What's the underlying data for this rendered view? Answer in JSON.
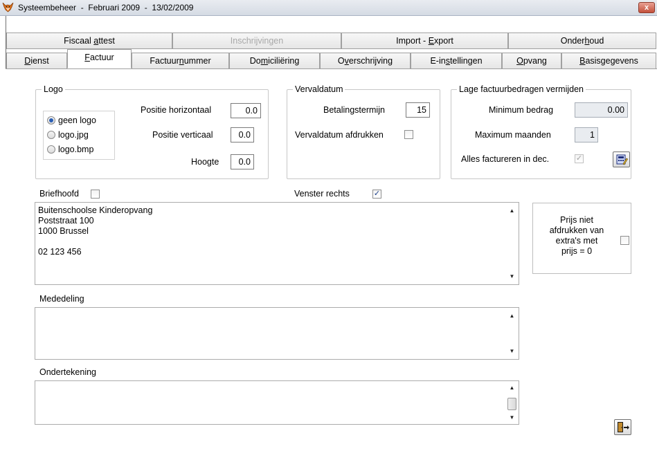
{
  "window": {
    "title": "Systeembeheer  -  Februari 2009  -  13/02/2009",
    "close_glyph": "x"
  },
  "tabs_top": [
    {
      "label_pre": "Fiscaal ",
      "label_u": "a",
      "label_post": "ttest",
      "enabled": true
    },
    {
      "label_pre": "Inschrijvingen",
      "label_u": "",
      "label_post": "",
      "enabled": false
    },
    {
      "label_pre": "Import - ",
      "label_u": "E",
      "label_post": "xport",
      "enabled": true
    },
    {
      "label_pre": "Onder",
      "label_u": "h",
      "label_post": "oud",
      "enabled": true
    }
  ],
  "tabs_bottom": [
    {
      "label_pre": "",
      "label_u": "D",
      "label_post": "ienst"
    },
    {
      "label_pre": "",
      "label_u": "F",
      "label_post": "actuur",
      "active": true
    },
    {
      "label_pre": "Factuur",
      "label_u": "n",
      "label_post": "ummer"
    },
    {
      "label_pre": "Do",
      "label_u": "m",
      "label_post": "iciliëring"
    },
    {
      "label_pre": "O",
      "label_u": "v",
      "label_post": "erschrijving"
    },
    {
      "label_pre": "E-in",
      "label_u": "s",
      "label_post": "tellingen"
    },
    {
      "label_pre": "",
      "label_u": "O",
      "label_post": "pvang"
    },
    {
      "label_pre": "",
      "label_u": "B",
      "label_post": "asisgegevens"
    }
  ],
  "logo": {
    "group_title": "Logo",
    "options": [
      {
        "label": "geen logo",
        "checked": true
      },
      {
        "label": "logo.jpg",
        "checked": false
      },
      {
        "label": "logo.bmp",
        "checked": false
      }
    ],
    "pos_h_label": "Positie horizontaal",
    "pos_h_value": "0.0",
    "pos_v_label": "Positie verticaal",
    "pos_v_value": "0.0",
    "height_label": "Hoogte",
    "height_value": "0.0"
  },
  "vervaldatum": {
    "group_title": "Vervaldatum",
    "term_label": "Betalingstermijn",
    "term_value": "15",
    "print_label": "Vervaldatum afdrukken",
    "print_checked": false
  },
  "lage": {
    "group_title": "Lage factuurbedragen vermijden",
    "min_label": "Minimum bedrag",
    "min_value": "0.00",
    "max_label": "Maximum maanden",
    "max_value": "1",
    "all_label": "Alles factureren in dec.",
    "all_checked": true
  },
  "briefhoofd": {
    "label": "Briefhoofd",
    "checked": false,
    "lines": [
      "Buitenschoolse Kinderopvang",
      "Poststraat 100",
      "1000 Brussel",
      "",
      "02 123 456"
    ]
  },
  "venster": {
    "label": "Venster rechts",
    "checked": true
  },
  "prijs": {
    "lines": [
      "Prijs niet",
      "afdrukken van",
      "extra's met",
      "prijs = 0"
    ],
    "checked": false
  },
  "mededeling": {
    "label": "Mededeling"
  },
  "ondertekening": {
    "label": "Ondertekening"
  },
  "icons": {
    "app": "fox-icon",
    "edit": "edit-calculator-icon",
    "exit": "exit-door-icon"
  }
}
